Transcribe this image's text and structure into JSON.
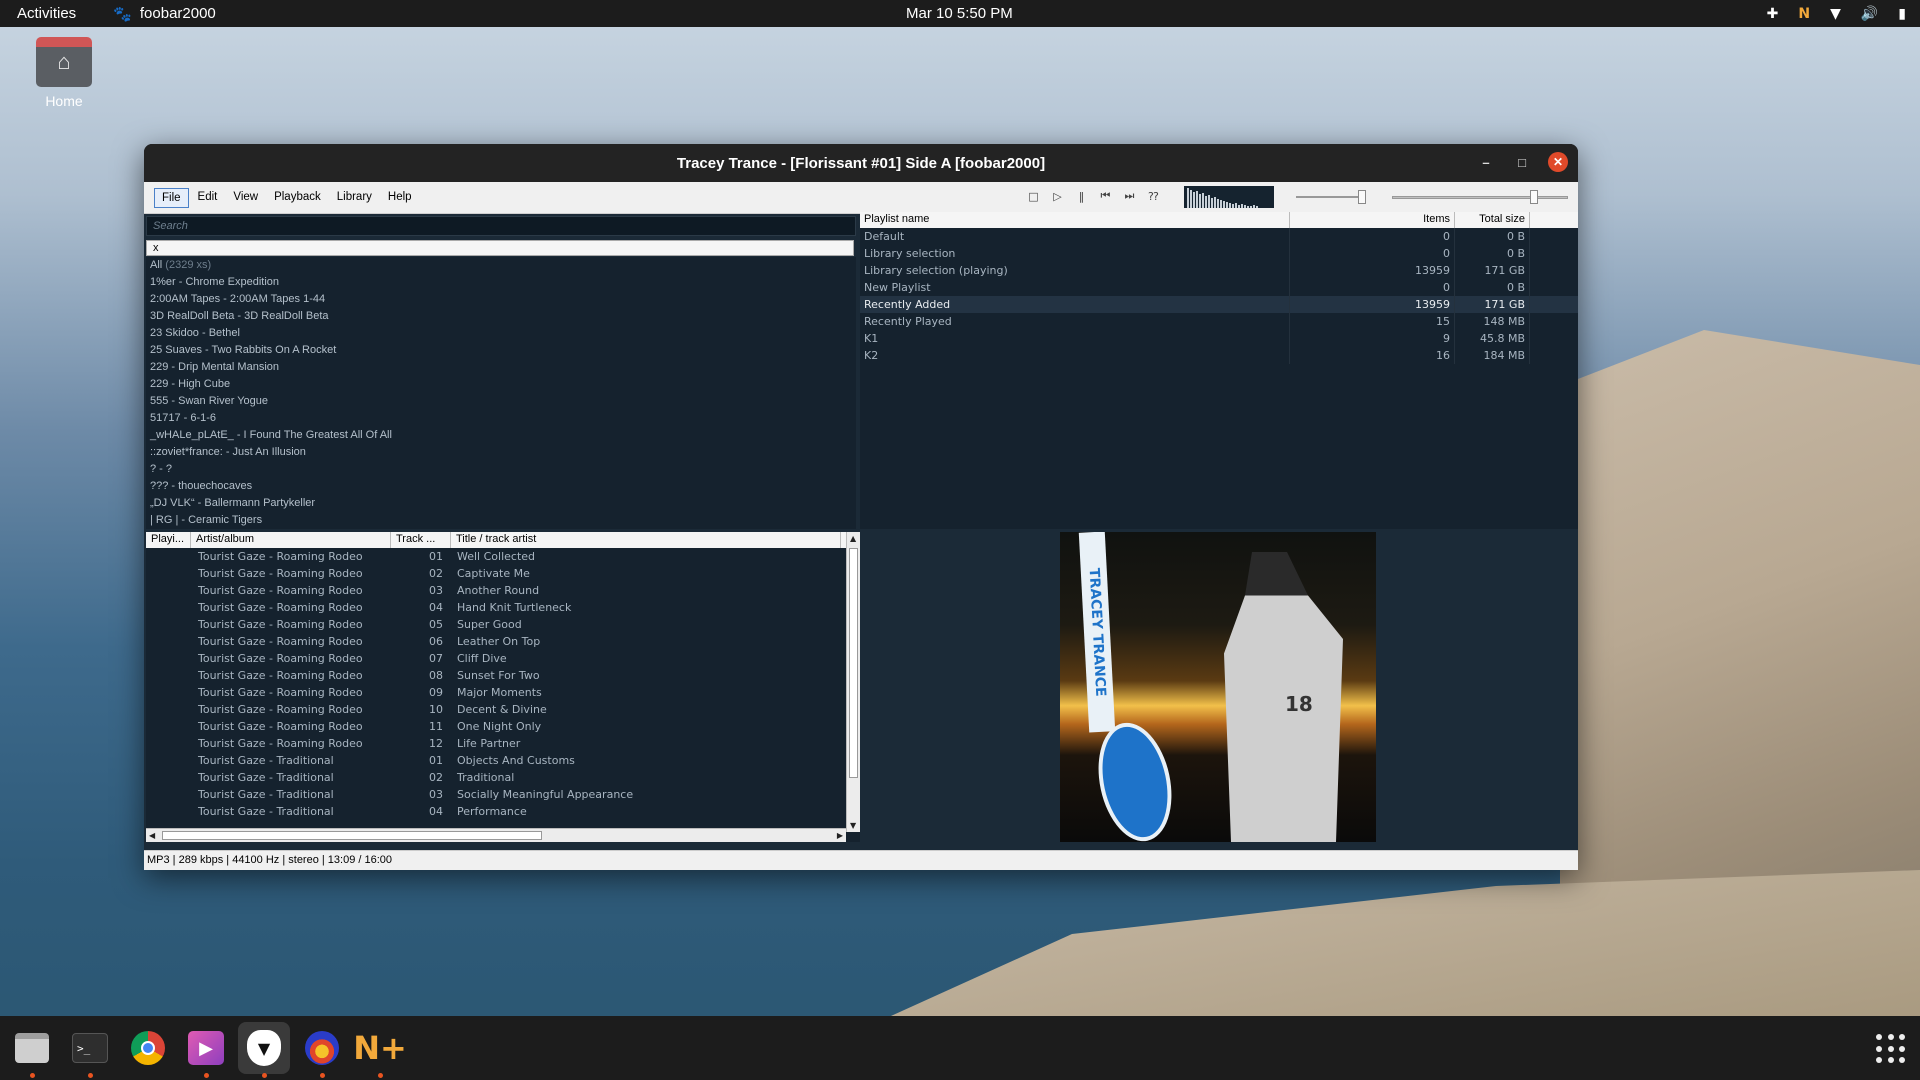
{
  "topbar": {
    "activities": "Activities",
    "app_name": "foobar2000",
    "clock": "Mar 10  5:50 PM",
    "tray_icons": [
      "extension-icon",
      "app-tray-icon",
      "wifi-icon",
      "volume-icon",
      "battery-icon"
    ]
  },
  "desktop": {
    "home_label": "Home"
  },
  "window": {
    "title": "Tracey Trance - [Florissant #01] Side A  [foobar2000]",
    "menu": [
      "File",
      "Edit",
      "View",
      "Playback",
      "Library",
      "Help"
    ],
    "transport_icons": [
      "stop-icon",
      "play-icon",
      "pause-icon",
      "prev-icon",
      "next-icon",
      "random-icon"
    ],
    "volume_level": 0.9,
    "seek_position": 0.82
  },
  "library": {
    "search_placeholder": "Search",
    "filter_value": "x",
    "all_label": "All",
    "all_count": "(2329 xs)",
    "items": [
      "1%er - Chrome Expedition",
      "2:00AM Tapes - 2:00AM Tapes 1-44",
      "3D RealDoll Beta - 3D RealDoll Beta",
      "23 Skidoo - Bethel",
      "25 Suaves - Two Rabbits On A Rocket",
      "229 - Drip Mental Mansion",
      "229 - High Cube",
      "555 - Swan River Yogue",
      "51717 - 6-1-6",
      "_wHALe_pLAtE_ - I Found The Greatest All Of All",
      "::zoviet*france: - Just An Illusion",
      "? - ?",
      "??? - thouechocaves",
      "„DJ VLK“ - Ballermann Partykeller",
      "| RG | - Ceramic Tigers"
    ]
  },
  "playlists": {
    "headers": {
      "name": "Playlist name",
      "items": "Items",
      "size": "Total size"
    },
    "rows": [
      {
        "name": "Default",
        "items": "0",
        "size": "0 B"
      },
      {
        "name": "Library selection",
        "items": "0",
        "size": "0 B"
      },
      {
        "name": "Library selection (playing)",
        "items": "13959",
        "size": "171 GB"
      },
      {
        "name": "New Playlist",
        "items": "0",
        "size": "0 B"
      },
      {
        "name": "Recently Added",
        "items": "13959",
        "size": "171 GB",
        "selected": true
      },
      {
        "name": "Recently Played",
        "items": "15",
        "size": "148 MB"
      },
      {
        "name": "K1",
        "items": "9",
        "size": "45.8 MB"
      },
      {
        "name": "K2",
        "items": "16",
        "size": "184 MB"
      }
    ]
  },
  "tracks": {
    "headers": {
      "pl": "Playi...",
      "artist": "Artist/album",
      "track": "Track ...",
      "title": "Title / track artist"
    },
    "rows": [
      {
        "artist": "Tourist Gaze - Roaming Rodeo",
        "num": "01",
        "title": "Well Collected"
      },
      {
        "artist": "Tourist Gaze - Roaming Rodeo",
        "num": "02",
        "title": "Captivate Me"
      },
      {
        "artist": "Tourist Gaze - Roaming Rodeo",
        "num": "03",
        "title": "Another Round"
      },
      {
        "artist": "Tourist Gaze - Roaming Rodeo",
        "num": "04",
        "title": "Hand Knit Turtleneck"
      },
      {
        "artist": "Tourist Gaze - Roaming Rodeo",
        "num": "05",
        "title": "Super Good"
      },
      {
        "artist": "Tourist Gaze - Roaming Rodeo",
        "num": "06",
        "title": "Leather On Top"
      },
      {
        "artist": "Tourist Gaze - Roaming Rodeo",
        "num": "07",
        "title": "Cliff Dive"
      },
      {
        "artist": "Tourist Gaze - Roaming Rodeo",
        "num": "08",
        "title": "Sunset For Two"
      },
      {
        "artist": "Tourist Gaze - Roaming Rodeo",
        "num": "09",
        "title": "Major Moments"
      },
      {
        "artist": "Tourist Gaze - Roaming Rodeo",
        "num": "10",
        "title": "Decent & Divine"
      },
      {
        "artist": "Tourist Gaze - Roaming Rodeo",
        "num": "11",
        "title": "One Night Only"
      },
      {
        "artist": "Tourist Gaze - Roaming Rodeo",
        "num": "12",
        "title": "Life Partner"
      },
      {
        "artist": "Tourist Gaze - Traditional",
        "num": "01",
        "title": "Objects And Customs"
      },
      {
        "artist": "Tourist Gaze - Traditional",
        "num": "02",
        "title": "Traditional"
      },
      {
        "artist": "Tourist Gaze - Traditional",
        "num": "03",
        "title": "Socially Meaningful Appearance"
      },
      {
        "artist": "Tourist Gaze - Traditional",
        "num": "04",
        "title": "Performance"
      }
    ]
  },
  "album_art": {
    "banner_text": "TRACEY TRANCE",
    "jersey_number": "18"
  },
  "status": "MP3 | 289 kbps | 44100 Hz | stereo | 13:09 / 16:00",
  "dock": {
    "items": [
      "files-icon",
      "terminal-icon",
      "chrome-icon",
      "media-player-icon",
      "foobar2000-icon",
      "audio-app-icon",
      "notes-plus-icon"
    ],
    "active": "foobar2000-icon"
  },
  "colors": {
    "accent_close": "#e04a2a",
    "dock_indicator": "#e95420",
    "pane_bg": "#15222e"
  }
}
